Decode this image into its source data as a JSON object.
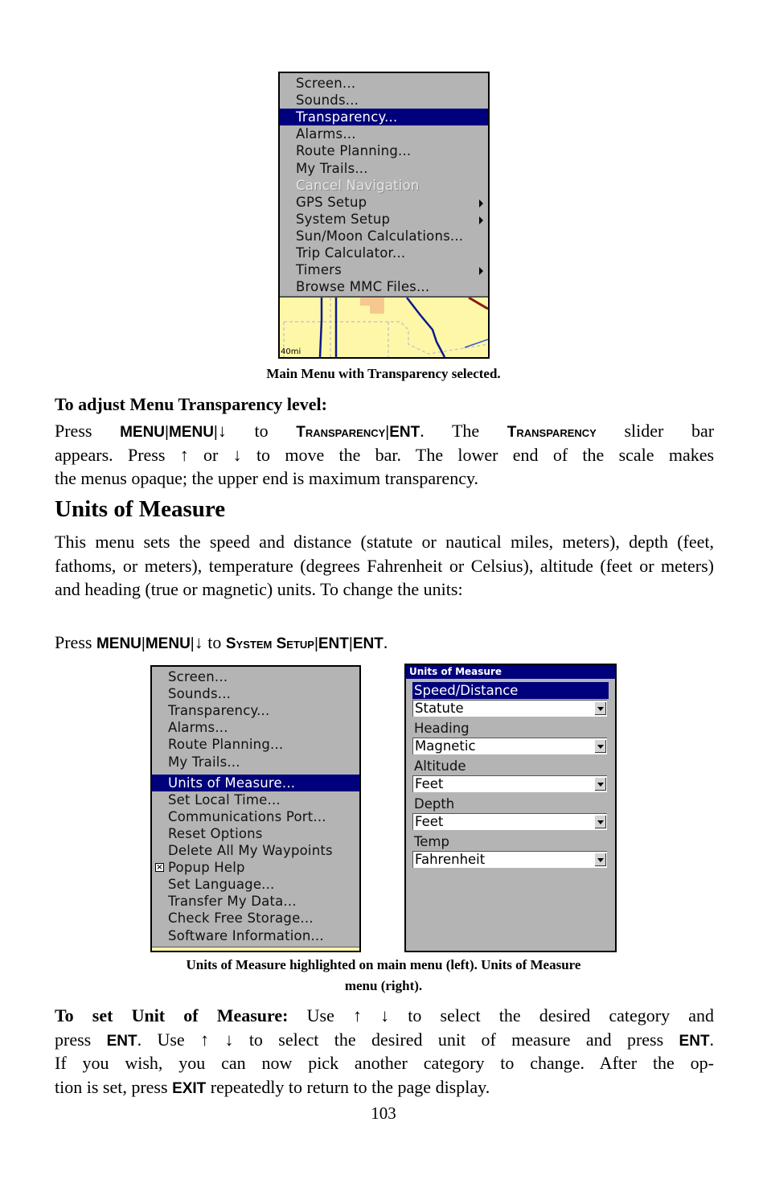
{
  "figure1": {
    "menu_items": [
      {
        "label": "Screen...",
        "state": "normal",
        "submenu": false
      },
      {
        "label": "Sounds...",
        "state": "normal",
        "submenu": false
      },
      {
        "label": "Transparency...",
        "state": "selected",
        "submenu": false
      },
      {
        "label": "Alarms...",
        "state": "normal",
        "submenu": false
      },
      {
        "label": "Route Planning...",
        "state": "normal",
        "submenu": false
      },
      {
        "label": "My Trails...",
        "state": "normal",
        "submenu": false
      },
      {
        "label": "Cancel Navigation",
        "state": "disabled",
        "submenu": false
      },
      {
        "label": "GPS Setup",
        "state": "normal",
        "submenu": true
      },
      {
        "label": "System Setup",
        "state": "normal",
        "submenu": true
      },
      {
        "label": "Sun/Moon Calculations...",
        "state": "normal",
        "submenu": false
      },
      {
        "label": "Trip Calculator...",
        "state": "normal",
        "submenu": false
      },
      {
        "label": "Timers",
        "state": "normal",
        "submenu": true
      },
      {
        "label": "Browse MMC Files...",
        "state": "normal",
        "submenu": false
      }
    ],
    "map_scale": "40mi",
    "caption": "Main Menu with Transparency selected."
  },
  "transparency_section": {
    "subheading": "To adjust Menu Transparency level:",
    "line1": {
      "press": "Press",
      "k1": "MENU",
      "k2": "MENU",
      "arrow_down": "↓",
      "to": "to",
      "k3": "Transparency",
      "k4": "ENT",
      "the": ". The",
      "k5": "Transparency",
      "rest": "slider bar"
    },
    "line2": {
      "pre": "appears. Press",
      "arrow_up": "↑",
      "or": "or",
      "arrow_down": "↓",
      "rest": "to move the bar. The lower end of the scale makes"
    },
    "line3": "the menus opaque; the upper end is maximum transparency."
  },
  "units_section": {
    "heading": "Units of Measure",
    "body": "This menu sets the speed and distance (statute or nautical miles, meters), depth (feet, fathoms, or meters), temperature (degrees Fahrenheit or Celsius), altitude (feet or meters) and heading (true or magnetic) units. To change the units:",
    "press_line": {
      "press": "Press",
      "k1": "MENU",
      "k2": "MENU",
      "arrow_down": "↓",
      "to": "to",
      "k3": "System Setup",
      "k4": "ENT",
      "k5": "ENT",
      "end": "."
    }
  },
  "figure2": {
    "menu_items": [
      {
        "label": "Screen...",
        "state": "normal"
      },
      {
        "label": "Sounds...",
        "state": "normal"
      },
      {
        "label": "Transparency...",
        "state": "normal"
      },
      {
        "label": "Alarms...",
        "state": "normal"
      },
      {
        "label": "Route Planning...",
        "state": "normal"
      },
      {
        "label": "My Trails...",
        "state": "normal"
      },
      {
        "label": "Units of Measure...",
        "state": "selected"
      },
      {
        "label": "Set Local Time...",
        "state": "normal"
      },
      {
        "label": "Communications Port...",
        "state": "normal"
      },
      {
        "label": "Reset Options",
        "state": "normal"
      },
      {
        "label": "Delete All My Waypoints",
        "state": "normal"
      },
      {
        "label": "Popup Help",
        "state": "checked"
      },
      {
        "label": "Set Language...",
        "state": "normal"
      },
      {
        "label": "Transfer My Data...",
        "state": "normal"
      },
      {
        "label": "Check Free Storage...",
        "state": "normal"
      },
      {
        "label": "Software Information...",
        "state": "normal"
      }
    ],
    "checkbox_mark": "×",
    "units_panel": {
      "title": "Units of Measure",
      "fields": [
        {
          "label": "Speed/Distance",
          "value": "Statute",
          "selected": true
        },
        {
          "label": "Heading",
          "value": "Magnetic",
          "selected": false
        },
        {
          "label": "Altitude",
          "value": "Feet",
          "selected": false
        },
        {
          "label": "Depth",
          "value": "Feet",
          "selected": false
        },
        {
          "label": "Temp",
          "value": "Fahrenheit",
          "selected": false
        }
      ]
    },
    "caption_line1": "Units of Measure highlighted on main menu (left). Units of Measure",
    "caption_line2": "menu (right)."
  },
  "set_unit_section": {
    "lead": "To set Unit of Measure:",
    "l1_a": "Use",
    "arrow_up": "↑",
    "arrow_down": "↓",
    "l1_b": "to select the desired category and",
    "l2_a": "press",
    "k_ent": "ENT",
    "l2_b": ". Use",
    "l2_c": "to select the desired unit of measure and press",
    "l2_end": ".",
    "l3": "If you wish, you can now pick another category to change. After the op-",
    "l4_a": "tion is set, press",
    "k_exit": "EXIT",
    "l4_b": "repeatedly to return to the page display."
  },
  "page_number": "103",
  "colors": {
    "selection": "#00007c",
    "menu_bg": "#b4b4b4",
    "map_bg": "#fff7a8",
    "road": "#0a1a8a"
  }
}
